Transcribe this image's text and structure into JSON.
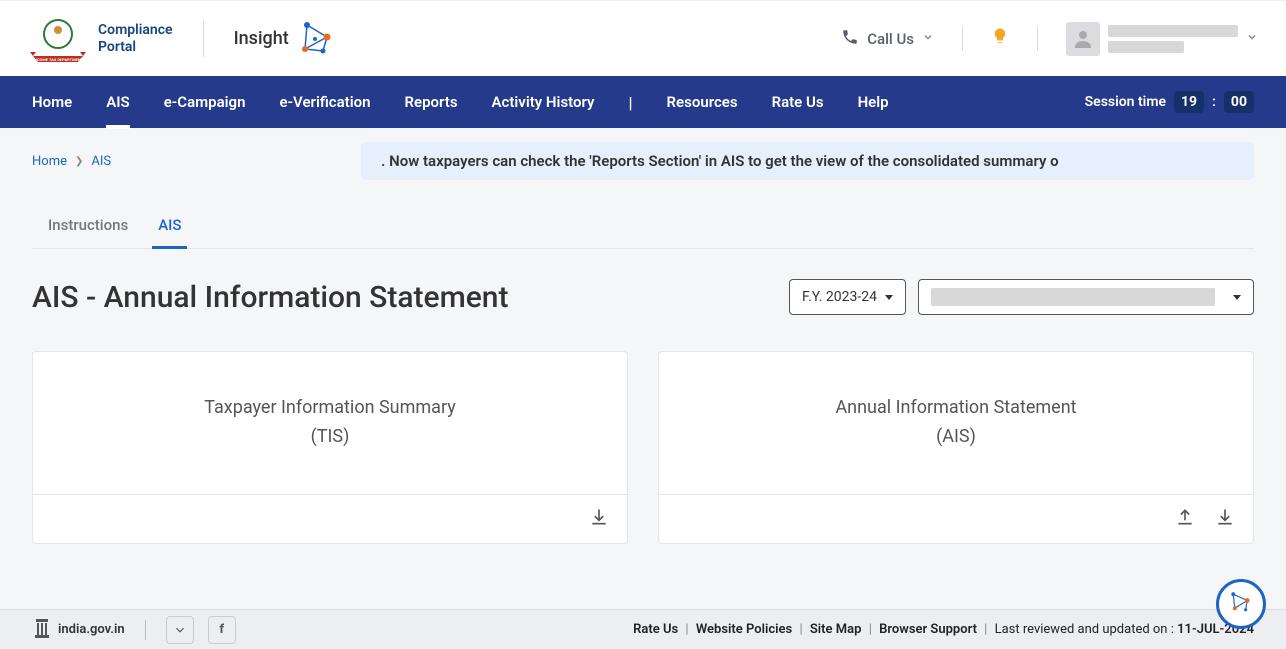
{
  "header": {
    "portal_name": "Compliance\nPortal",
    "insight_label": "Insight",
    "call_us": "Call Us"
  },
  "nav": {
    "items": [
      "Home",
      "AIS",
      "e-Campaign",
      "e-Verification",
      "Reports",
      "Activity History",
      "Resources",
      "Rate Us",
      "Help"
    ],
    "session_label": "Session time",
    "session_min": "19",
    "session_sec": "00"
  },
  "breadcrumb": {
    "home": "Home",
    "ais": "AIS"
  },
  "marquee_text": ". Now taxpayers can check the 'Reports Section' in AIS to get the view of the consolidated summary o",
  "tabs": {
    "instructions": "Instructions",
    "ais": "AIS"
  },
  "page_title": "AIS - Annual Information Statement",
  "fy_select": "F.Y. 2023-24",
  "cards": {
    "tis_line1": "Taxpayer Information Summary",
    "tis_line2": "(TIS)",
    "ais_line1": "Annual Information Statement",
    "ais_line2": "(AIS)"
  },
  "footer": {
    "india_gov": "india.gov.in",
    "rate_us": "Rate Us",
    "policies": "Website Policies",
    "sitemap": "Site Map",
    "support": "Browser Support",
    "reviewed": "Last reviewed and updated on : ",
    "date": "11-JUL-2024"
  }
}
